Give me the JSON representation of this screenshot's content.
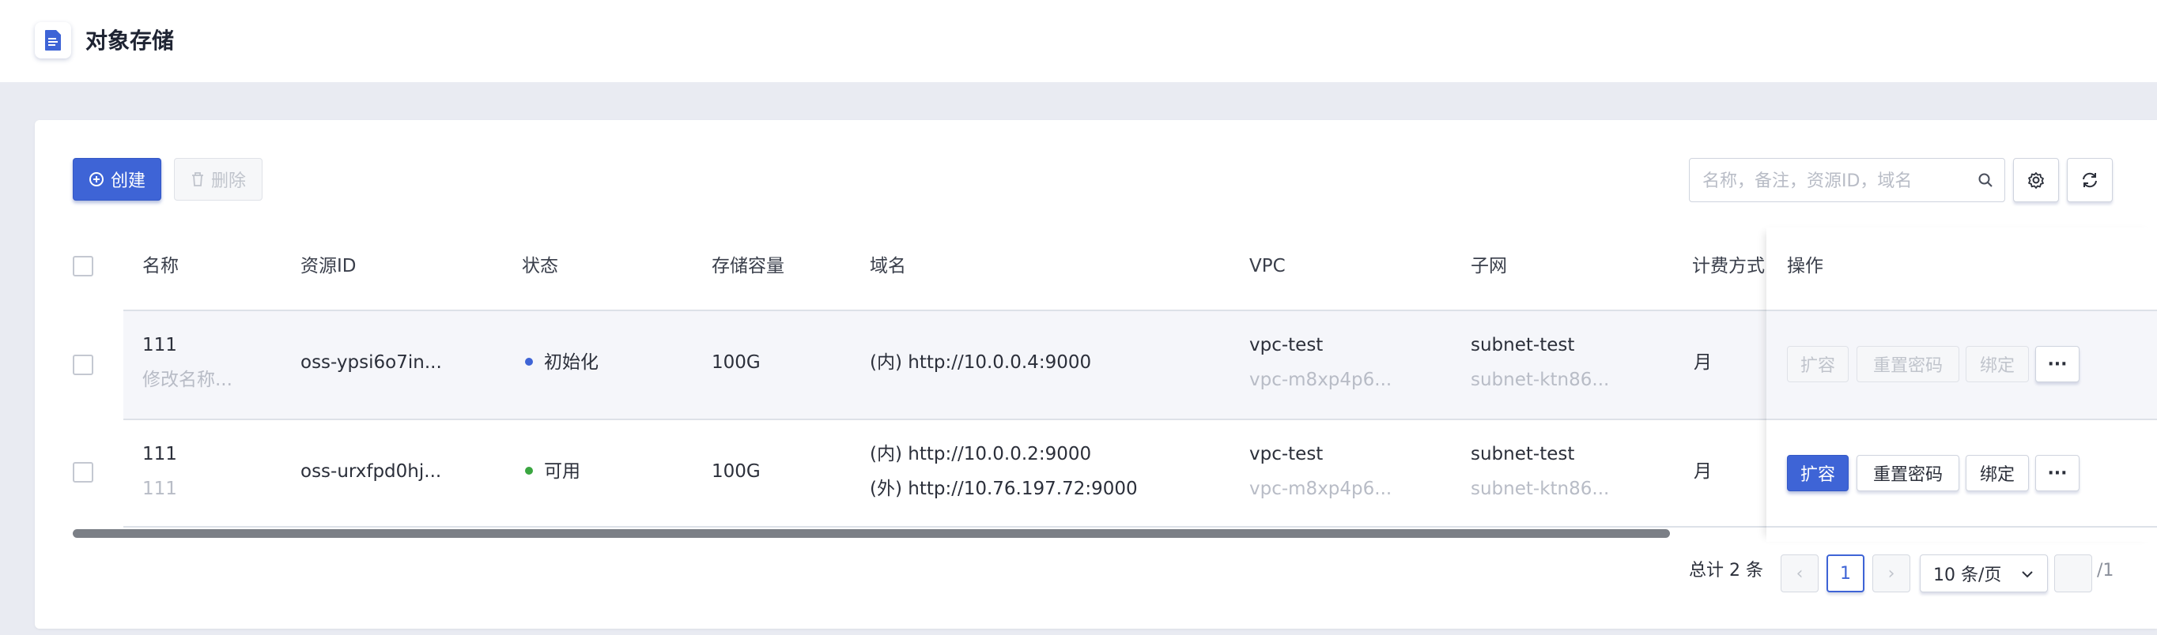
{
  "header": {
    "title": "对象存储",
    "icon": "document-icon"
  },
  "toolbar": {
    "create_label": "创建",
    "delete_label": "删除",
    "search_placeholder": "名称，备注，资源ID，域名"
  },
  "table": {
    "columns": [
      "名称",
      "资源ID",
      "状态",
      "存储容量",
      "域名",
      "VPC",
      "子网",
      "计费方式",
      "操作"
    ],
    "rows": [
      {
        "name": "111",
        "remark": "修改名称...",
        "resource_id": "oss-ypsi6o7in...",
        "status": "初始化",
        "status_color": "#3e64d6",
        "capacity": "100G",
        "domain_inner": "(内) http://10.0.0.4:9000",
        "domain_outer": "",
        "vpc": "vpc-test",
        "vpc_id": "vpc-m8xp4p6...",
        "subnet": "subnet-test",
        "subnet_id": "subnet-ktn86...",
        "billing": "月",
        "actions": {
          "expand": "扩容",
          "reset_password": "重置密码",
          "bind": "绑定",
          "more": "···"
        },
        "actions_enabled": false
      },
      {
        "name": "111",
        "remark": "111",
        "resource_id": "oss-urxfpd0hj...",
        "status": "可用",
        "status_color": "#3aa640",
        "capacity": "100G",
        "domain_inner": "(内) http://10.0.0.2:9000",
        "domain_outer": "(外) http://10.76.197.72:9000",
        "vpc": "vpc-test",
        "vpc_id": "vpc-m8xp4p6...",
        "subnet": "subnet-test",
        "subnet_id": "subnet-ktn86...",
        "billing": "月",
        "actions": {
          "expand": "扩容",
          "reset_password": "重置密码",
          "bind": "绑定",
          "more": "···"
        },
        "actions_enabled": true
      }
    ]
  },
  "pagination": {
    "total_label": "总计 2 条",
    "current_page": "1",
    "page_size": "10 条/页",
    "total_pages": "/1",
    "prev": "‹",
    "next": "›"
  },
  "colors": {
    "primary": "#3e64d6",
    "background": "#e9ebf2"
  }
}
